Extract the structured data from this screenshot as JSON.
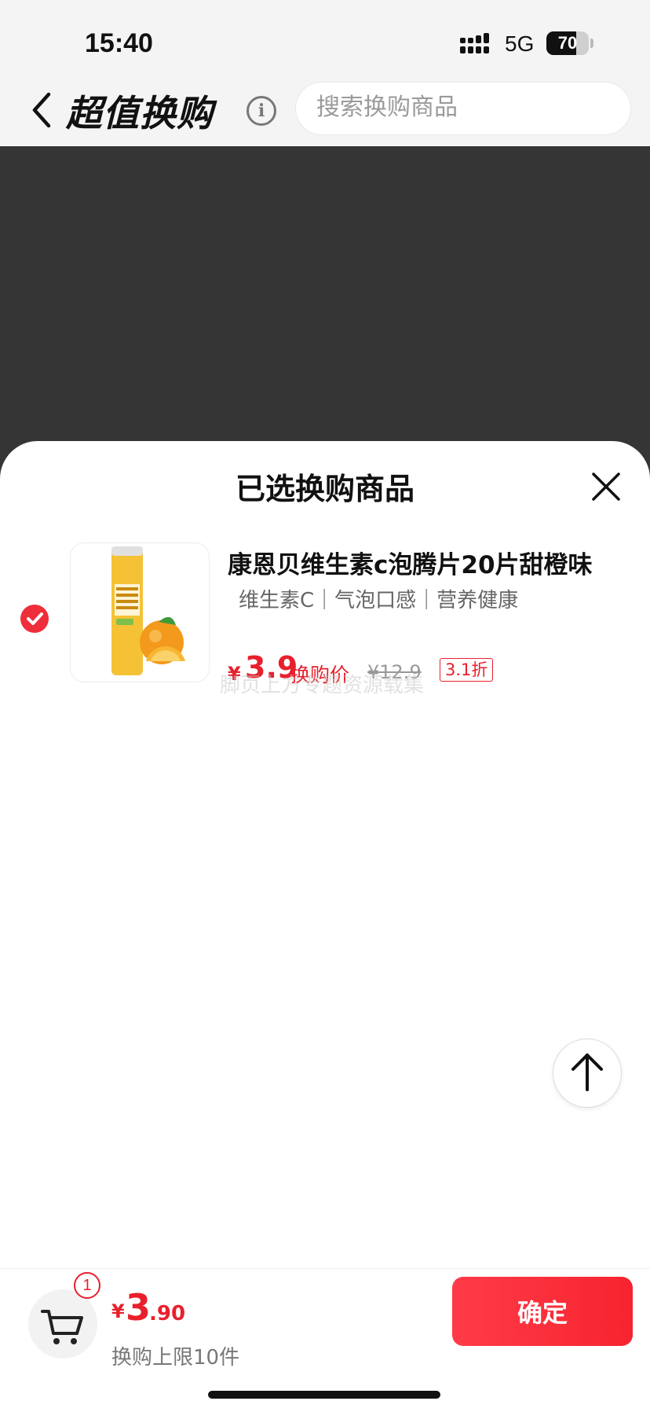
{
  "status_bar": {
    "time": "15:40",
    "network": "5G",
    "battery": "70",
    "battery_level": 0.7
  },
  "nav": {
    "title": "超值换购",
    "search_placeholder": "搜索换购商品"
  },
  "sheet": {
    "title": "已选换购商品",
    "product": {
      "name": "康恩贝维生素c泡腾片20片甜橙味",
      "tags": "维生素C｜气泡口感｜营养健康",
      "currency": "¥",
      "price": "3.9",
      "price_label": "换购价",
      "original_price": "¥12.9",
      "discount": "3.1折",
      "selected": true
    }
  },
  "watermark": "脚页上方专题资源载集",
  "bottom_bar": {
    "cart_count": "1",
    "currency": "¥",
    "total_int": "3",
    "total_dec": ".90",
    "limit_text": "换购上限10件",
    "confirm_label": "确定"
  },
  "colors": {
    "accent": "#e8202c",
    "overlay": "#353535",
    "nav_bg": "#f4f4f4"
  }
}
